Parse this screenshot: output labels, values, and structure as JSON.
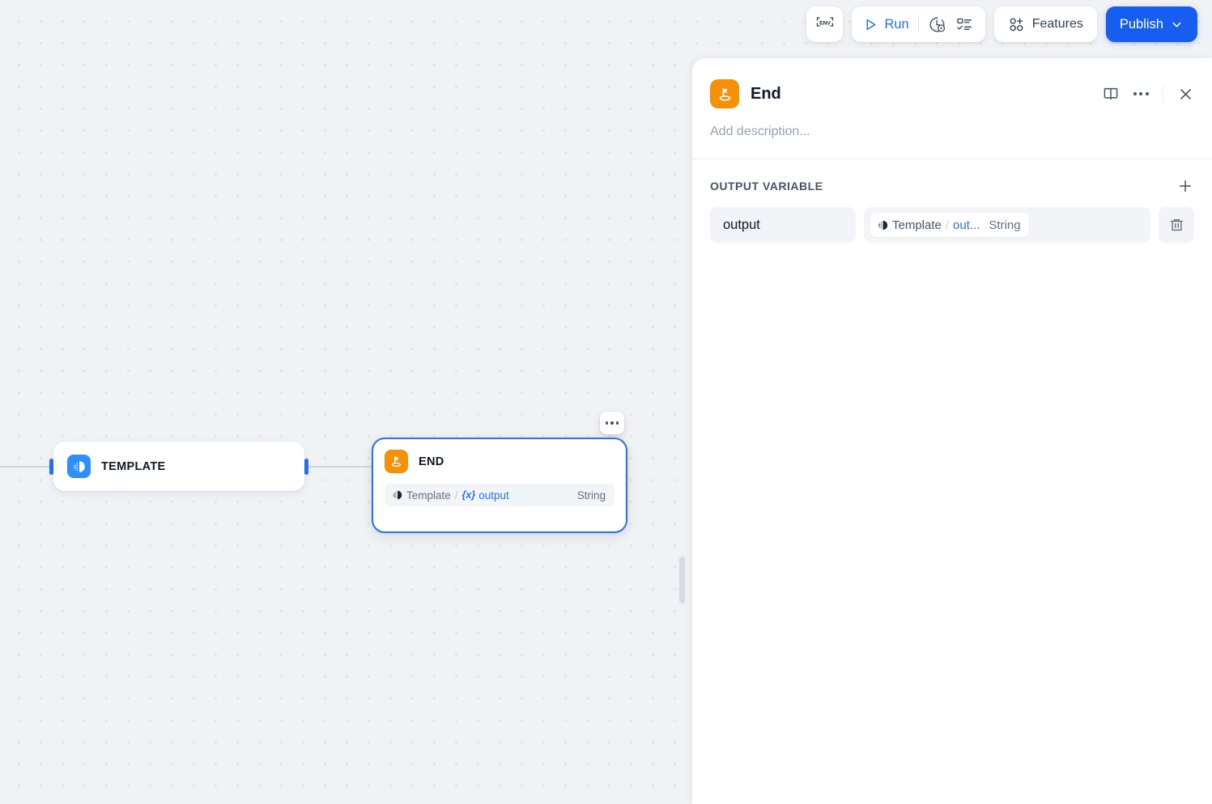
{
  "toolbar": {
    "env_label": "ENV",
    "env_icon": "env-brackets-icon",
    "run_label": "Run",
    "run_icon": "play-triangle-icon",
    "history_icon": "clock-play-history-icon",
    "checklist_icon": "checklist-icon",
    "features_label": "Features",
    "features_icon": "nodes-plus-icon",
    "publish_label": "Publish",
    "publish_caret_icon": "chevron-down-icon",
    "publish_color": "#155eef",
    "run_color": "#2970ff"
  },
  "canvas": {
    "nodes": [
      {
        "id": "template",
        "title": "TEMPLATE",
        "icon": "template-transform-icon",
        "icon_color": "#2e90fa"
      },
      {
        "id": "end",
        "title": "END",
        "icon": "end-flag-icon",
        "icon_color": "#f79009",
        "selected": true,
        "variable": {
          "source": "Template",
          "separator": "/",
          "prefix": "{x}",
          "name": "output",
          "type": "String"
        }
      }
    ],
    "node_menu_icon": "more-horizontal-icon"
  },
  "panel": {
    "icon": "end-flag-icon",
    "icon_color": "#f79009",
    "title": "End",
    "book_icon": "book-open-icon",
    "more_icon": "more-horizontal-icon",
    "close_icon": "close-x-icon",
    "description_placeholder": "Add description...",
    "section": {
      "title": "OUTPUT VARIABLE",
      "add_icon": "plus-icon",
      "rows": [
        {
          "key": "output",
          "chip_icon": "template-transform-icon",
          "chip_source": "Template",
          "chip_separator": "/",
          "chip_name": "out...",
          "chip_type": "String",
          "delete_icon": "trash-icon"
        }
      ]
    }
  }
}
